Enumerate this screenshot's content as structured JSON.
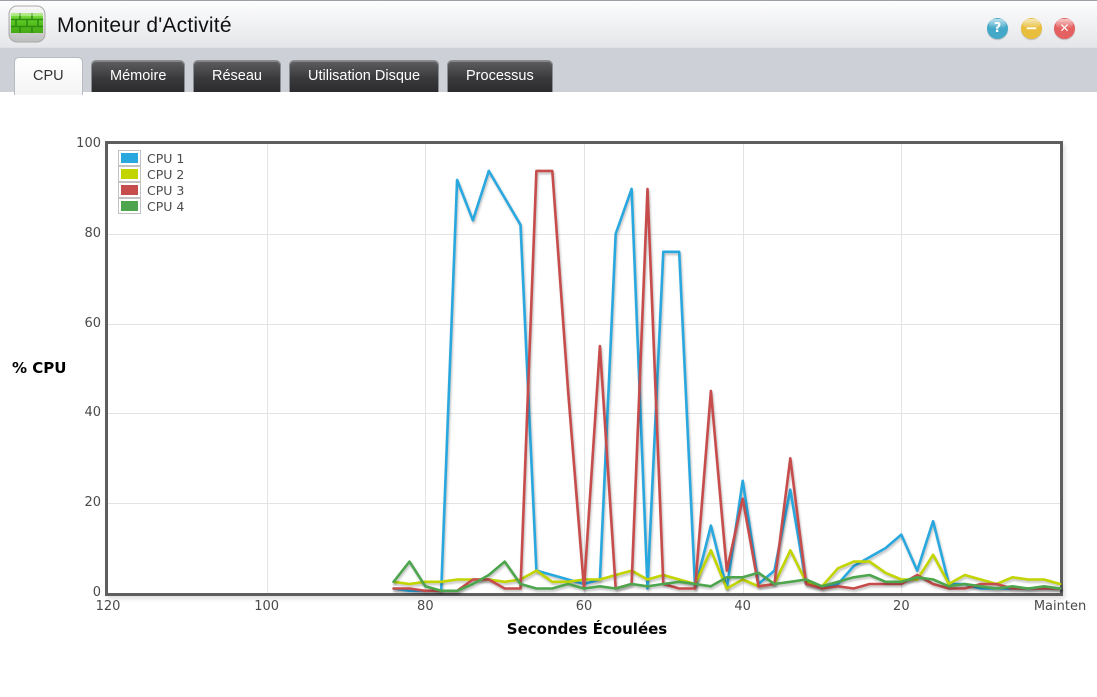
{
  "window": {
    "title": "Moniteur d'Activité",
    "controls": {
      "help": "?",
      "minimize": "−",
      "close": "✕"
    }
  },
  "tabs": [
    {
      "label": "CPU",
      "active": true
    },
    {
      "label": "Mémoire",
      "active": false
    },
    {
      "label": "Réseau",
      "active": false
    },
    {
      "label": "Utilisation Disque",
      "active": false
    },
    {
      "label": "Processus",
      "active": false
    }
  ],
  "chart_data": {
    "type": "line",
    "title": "",
    "xlabel": "Secondes Écoulées",
    "ylabel": "% CPU",
    "xlim": [
      120,
      0
    ],
    "ylim": [
      0,
      100
    ],
    "grid": true,
    "legend_position": "top-left",
    "x_ticks": [
      {
        "value": 120,
        "label": "120"
      },
      {
        "value": 100,
        "label": "100"
      },
      {
        "value": 80,
        "label": "80"
      },
      {
        "value": 60,
        "label": "60"
      },
      {
        "value": 40,
        "label": "40"
      },
      {
        "value": 20,
        "label": "20"
      },
      {
        "value": 0,
        "label": "Mainten"
      }
    ],
    "y_ticks": [
      0,
      20,
      40,
      60,
      80,
      100
    ],
    "x": [
      84,
      82,
      80,
      78,
      76,
      74,
      72,
      70,
      68,
      66,
      64,
      62,
      60,
      58,
      56,
      54,
      52,
      50,
      48,
      46,
      44,
      42,
      40,
      38,
      36,
      34,
      32,
      30,
      28,
      26,
      24,
      22,
      20,
      18,
      16,
      14,
      12,
      10,
      8,
      6,
      4,
      2,
      0
    ],
    "series": [
      {
        "name": "CPU 1",
        "color": "#29a8df",
        "values": [
          1,
          0.5,
          0.5,
          0.5,
          92,
          83,
          94,
          88,
          82,
          5,
          4,
          3,
          2,
          3,
          80,
          90,
          1,
          76,
          76,
          1,
          15,
          1,
          25,
          2,
          5,
          23,
          2,
          1,
          2,
          6,
          8,
          10,
          13,
          5,
          16,
          2,
          2,
          1,
          1,
          1,
          1,
          1,
          1
        ]
      },
      {
        "name": "CPU 2",
        "color": "#c2d500",
        "values": [
          2.5,
          2,
          2.5,
          2.5,
          3,
          3,
          3,
          2.5,
          3,
          5,
          2.5,
          2.5,
          3,
          3,
          4,
          5,
          3,
          4,
          3,
          2,
          9.5,
          1,
          3,
          1.5,
          2,
          9.5,
          2.5,
          1.5,
          5.5,
          7,
          7,
          4.5,
          3,
          3,
          8.5,
          2,
          4,
          3,
          2,
          3.5,
          3,
          3,
          2
        ]
      },
      {
        "name": "CPU 3",
        "color": "#c74c4c",
        "values": [
          1,
          1,
          0.5,
          0.5,
          0.5,
          3,
          3,
          1,
          1,
          94,
          94,
          45,
          1,
          55,
          1,
          2,
          90,
          2,
          1,
          1,
          45,
          5,
          21,
          1.5,
          2,
          30,
          2,
          1,
          1.5,
          1,
          2,
          2,
          2,
          4,
          2,
          1,
          1,
          2,
          2,
          1,
          1,
          1,
          1
        ]
      },
      {
        "name": "CPU 4",
        "color": "#4da64d",
        "values": [
          2.5,
          7,
          1.5,
          0.5,
          0.5,
          2,
          4,
          7,
          2,
          1,
          1,
          2,
          1,
          1.5,
          1,
          2,
          1.5,
          2,
          2.5,
          2,
          1.5,
          3.5,
          3.5,
          4.5,
          2,
          2.5,
          3,
          1.5,
          2.5,
          3.5,
          4,
          2.5,
          2.5,
          3.5,
          3,
          1.5,
          2,
          1.5,
          1,
          1.5,
          1,
          1.5,
          1
        ]
      }
    ]
  }
}
